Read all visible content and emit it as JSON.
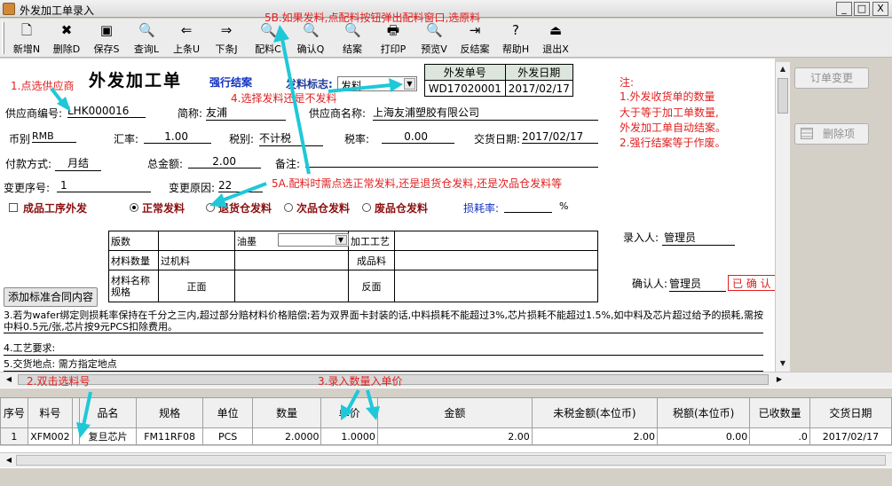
{
  "window": {
    "title": "外发加工单录入",
    "min": "_",
    "max": "□",
    "close": "X"
  },
  "toolbar": [
    {
      "id": "new",
      "label": "新增N",
      "icon": "🗋",
      "icon_name": "new-doc-icon"
    },
    {
      "id": "delete",
      "label": "删除D",
      "icon": "✖",
      "icon_name": "delete-x-icon"
    },
    {
      "id": "save",
      "label": "保存S",
      "icon": "▣",
      "icon_name": "floppy-disk-icon"
    },
    {
      "id": "query",
      "label": "查询L",
      "icon": "🔍",
      "icon_name": "magnifier-icon"
    },
    {
      "id": "prev",
      "label": "上条U",
      "icon": "⇐",
      "icon_name": "arrow-left-icon"
    },
    {
      "id": "next",
      "label": "下条J",
      "icon": "⇒",
      "icon_name": "arrow-right-icon"
    },
    {
      "id": "material",
      "label": "配料C",
      "icon": "🔍",
      "icon_name": "magnifier-icon"
    },
    {
      "id": "confirm",
      "label": "确认Q",
      "icon": "🔍",
      "icon_name": "magnifier-icon"
    },
    {
      "id": "close_case",
      "label": "结案",
      "icon": "🔍",
      "icon_name": "magnifier-icon"
    },
    {
      "id": "print",
      "label": "打印P",
      "icon": "🖶",
      "icon_name": "printer-icon"
    },
    {
      "id": "preview",
      "label": "预览V",
      "icon": "🔍",
      "icon_name": "magnifier-icon"
    },
    {
      "id": "unclose",
      "label": "反结案",
      "icon": "⇥",
      "icon_name": "arrow-right-bar-icon"
    },
    {
      "id": "help",
      "label": "帮助H",
      "icon": "?",
      "icon_name": "help-icon"
    },
    {
      "id": "exit",
      "label": "退出X",
      "icon": "⏏",
      "icon_name": "exit-door-icon"
    }
  ],
  "form": {
    "title": "外发加工单",
    "force_close": "强行结案",
    "issue_flag_label": "发料标志:",
    "issue_flag_value": "发料",
    "order_no_header": "外发单号",
    "order_date_header": "外发日期",
    "order_no": "WD17020001",
    "order_date": "2017/02/17",
    "supplier_code_label": "供应商编号:",
    "supplier_code": "LHK000016",
    "short_name_label": "简称:",
    "short_name": "友浦",
    "supplier_name_label": "供应商名称:",
    "supplier_name": "上海友浦塑胶有限公司",
    "currency_label": "币别",
    "currency": "RMB",
    "rate_label": "汇率:",
    "rate": "1.00",
    "tax_type_label": "税别:",
    "tax_type": "不计税",
    "tax_rate_label": "税率:",
    "tax_rate": "0.00",
    "delivery_date_label": "交货日期:",
    "delivery_date": "2017/02/17",
    "payment_label": "付款方式:",
    "payment": "月结",
    "total_label": "总金额:",
    "total": "2.00",
    "remark_label": "备注:",
    "change_no_label": "变更序号:",
    "change_no": "1",
    "change_reason_label": "变更原因:",
    "change_reason": "22",
    "finished_outsource": "成品工序外发",
    "radio_normal": "正常发料",
    "radio_return": "退货仓发料",
    "radio_secondary": "次品仓发料",
    "radio_waste": "废品仓发料",
    "loss_rate_label": "损耗率:",
    "percent": "%",
    "entered_by_label": "录入人:",
    "entered_by": "管理员",
    "confirmed_by_label": "确认人:",
    "confirmed_by": "管理员",
    "confirmed_stamp": "已 确 认",
    "add_contract_btn": "添加标准合同内容",
    "clause3": "3.若为wafer绑定则损耗率保持在千分之三内,超过部分赔材料价格赔偿;若为双界面卡封装的话,中料损耗不能超过3%,芯片损耗不能超过1.5%,如中料及芯片超过给予的损耗,需按中料0.5元/张,芯片按9元PCS扣除费用。",
    "clause4": "4.工艺要求:",
    "clause5": "5.交货地点: 需方指定地点"
  },
  "material_table": {
    "version": "版数",
    "ink": "油墨",
    "process": "加工工艺",
    "material_qty": "材料数量",
    "overlay": "过机料",
    "finished": "成品料",
    "material_spec": "材料名称规格",
    "front": "正面",
    "back": "反面"
  },
  "side_buttons": {
    "order_change": "订单变更",
    "delete_item": "删除项"
  },
  "note": {
    "title": "注:",
    "line1": "1.外发收货单的数量",
    "line2": "大于等于加工单数量,",
    "line3": "外发加工单自动结案。",
    "line4": "2.强行结案等于作废。"
  },
  "annotations": {
    "a1": "1.点选供应商",
    "a2": "2.双击选料号",
    "a3": "3.录入数量入单价",
    "a4": "4.选择发料还是不发料",
    "a5a": "5A.配料时需点选正常发料,还是退货仓发料,还是次品仓发料等",
    "a5b": "5B.如果发料,点配料按钮弹出配料窗口,选原料"
  },
  "grid": {
    "headers": [
      "序号",
      "料号",
      "",
      "品名",
      "规格",
      "单位",
      "数量",
      "单价",
      "金额",
      "未税金额(本位币)",
      "税额(本位币)",
      "已收数量",
      "交货日期"
    ],
    "rows": [
      [
        "1",
        "XFM002",
        "",
        "复旦芯片",
        "FM11RF08",
        "PCS",
        "2.0000",
        "1.0000",
        "2.00",
        "2.00",
        "0.00",
        ".0",
        "2017/02/17"
      ]
    ]
  },
  "colors": {
    "annotation": "#e02020",
    "arrow": "#1fc8d8",
    "title_blue": "#1030c0",
    "loss_link": "#1030c0"
  }
}
